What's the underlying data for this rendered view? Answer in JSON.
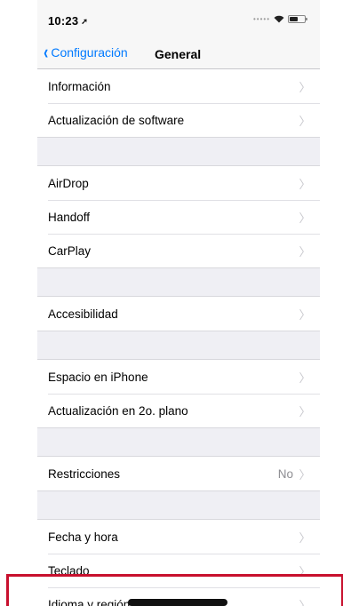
{
  "status": {
    "time": "10:23"
  },
  "nav": {
    "back_label": "Configuración",
    "title": "General"
  },
  "groups": [
    {
      "cells": [
        {
          "label": "Información"
        },
        {
          "label": "Actualización de software"
        }
      ]
    },
    {
      "cells": [
        {
          "label": "AirDrop"
        },
        {
          "label": "Handoff"
        },
        {
          "label": "CarPlay"
        }
      ]
    },
    {
      "cells": [
        {
          "label": "Accesibilidad"
        }
      ]
    },
    {
      "cells": [
        {
          "label": "Espacio en iPhone"
        },
        {
          "label": "Actualización en 2o. plano"
        }
      ]
    },
    {
      "cells": [
        {
          "label": "Restricciones",
          "value": "No"
        }
      ]
    },
    {
      "cells": [
        {
          "label": "Fecha y hora"
        },
        {
          "label": "Teclado"
        },
        {
          "label": "Idioma y región"
        }
      ]
    }
  ],
  "colors": {
    "accent": "#007aff",
    "highlight": "#c8102e"
  }
}
